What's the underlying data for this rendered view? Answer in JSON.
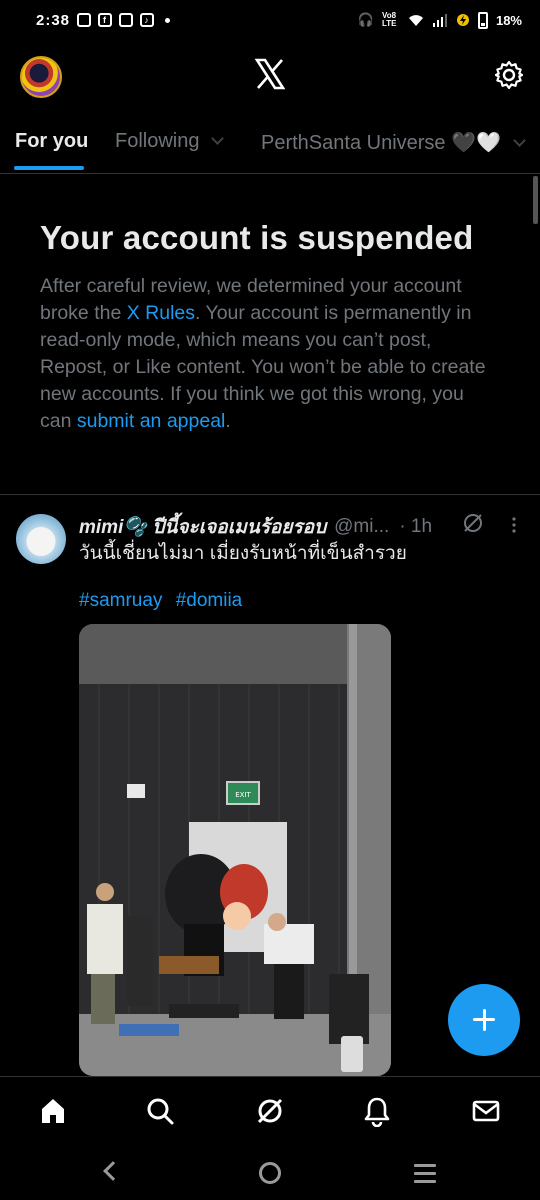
{
  "status_bar": {
    "time": "2:38",
    "app_icons": [
      "instagram-icon",
      "facebook-icon",
      "instagram-icon",
      "tiktok-icon"
    ],
    "network_label": "Vo8 LTE",
    "battery": "18%"
  },
  "header": {
    "logo": "X"
  },
  "tabs": [
    {
      "label": "For you",
      "active": true
    },
    {
      "label": "Following",
      "active": false
    },
    {
      "label": "PerthSanta Universe 🖤🤍",
      "active": false
    }
  ],
  "notice": {
    "title": "Your account is suspended",
    "body_part1": "After careful review, we determined your account broke the ",
    "rules_link": "X Rules",
    "body_part2": ". Your account is permanently in read-only mode, which means you can’t post, Repost, or Like content. You won’t be able to create new accounts. If you think we got this wrong, you can ",
    "appeal_link": "submit an appeal",
    "body_part3": "."
  },
  "post": {
    "display_name": "mimi🫧 ปีนี้จะเจอเมนร้อยรอบ",
    "handle": "@mi...",
    "time": "· 1h",
    "text": "วันนี้เชี่ยนไม่มา เมี่ยงรับหน้าที่เข็นสำรวย",
    "hashtags": [
      "#samruay",
      "#domiia"
    ],
    "exit_sign": "EXIT"
  },
  "nav": [
    "home",
    "search",
    "grok",
    "notifications",
    "messages"
  ],
  "colors": {
    "accent": "#1d9bf0",
    "background": "#000000",
    "muted_text": "#71767b",
    "primary_text": "#e7e9ea"
  }
}
